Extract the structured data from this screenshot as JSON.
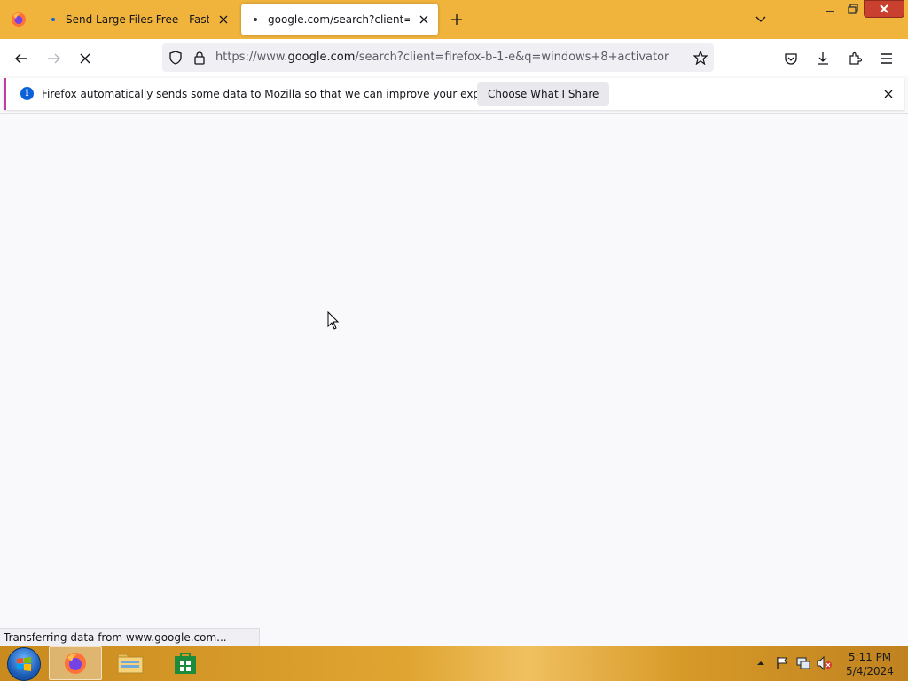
{
  "browser": {
    "tabs": [
      {
        "title": "Send Large Files Free - Fast Sec",
        "active": false
      },
      {
        "title": "google.com/search?client=firef",
        "active": true
      }
    ],
    "url": {
      "prefix": "https://www.",
      "domain": "google.com",
      "path": "/search?client=firefox-b-1-e&q=windows+8+activator"
    }
  },
  "notification": {
    "message": "Firefox automatically sends some data to Mozilla so that we can improve your experience.",
    "button_label": "Choose What I Share"
  },
  "status_text": "Transferring data from www.google.com...",
  "taskbar": {
    "time": "5:11 PM",
    "date": "5/4/2024"
  },
  "colors": {
    "theme_accent": "#f0b43c",
    "notification_accent": "#c23aa3",
    "info_blue": "#0b62d8"
  }
}
